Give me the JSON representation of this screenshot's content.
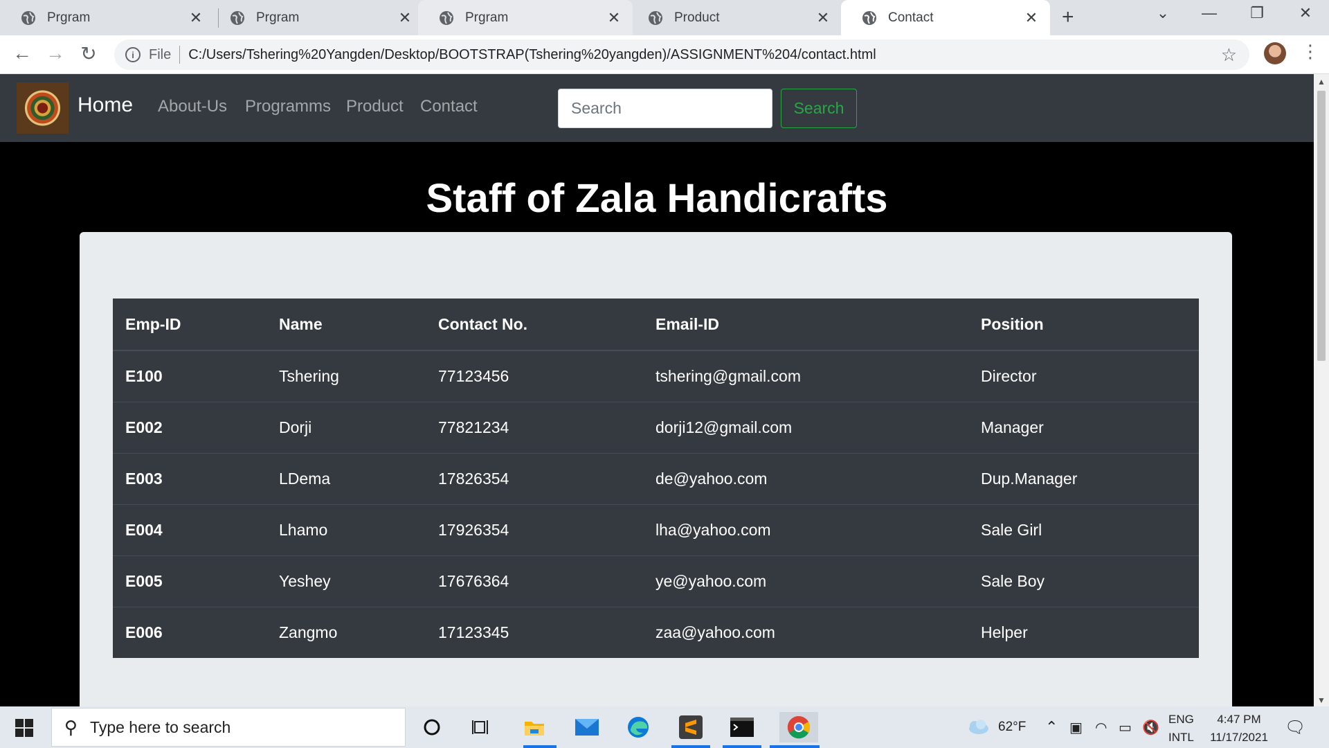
{
  "browser": {
    "tabs": [
      {
        "title": "Prgram",
        "active": false
      },
      {
        "title": "Prgram",
        "active": false
      },
      {
        "title": "Prgram",
        "active": false
      },
      {
        "title": "Product",
        "active": false
      },
      {
        "title": "Contact",
        "active": true
      }
    ],
    "address": {
      "scheme_label": "File",
      "url": "C:/Users/Tshering%20Yangden/Desktop/BOOTSTRAP(Tshering%20yangden)/ASSIGNMENT%204/contact.html"
    }
  },
  "navbar": {
    "brand": "Home",
    "links": [
      "About-Us",
      "Programms",
      "Product",
      "Contact"
    ],
    "search_placeholder": "Search",
    "search_button": "Search"
  },
  "page": {
    "title": "Staff of Zala Handicrafts"
  },
  "table": {
    "headers": [
      "Emp-ID",
      "Name",
      "Contact No.",
      "Email-ID",
      "Position"
    ],
    "rows": [
      [
        "E100",
        "Tshering",
        "77123456",
        "tshering@gmail.com",
        "Director"
      ],
      [
        "E002",
        "Dorji",
        "77821234",
        "dorji12@gmail.com",
        "Manager"
      ],
      [
        "E003",
        "LDema",
        "17826354",
        "de@yahoo.com",
        "Dup.Manager"
      ],
      [
        "E004",
        "Lhamo",
        "17926354",
        "lha@yahoo.com",
        "Sale Girl"
      ],
      [
        "E005",
        "Yeshey",
        "17676364",
        "ye@yahoo.com",
        "Sale Boy"
      ],
      [
        "E006",
        "Zangmo",
        "17123345",
        "zaa@yahoo.com",
        "Helper"
      ]
    ]
  },
  "taskbar": {
    "search_placeholder": "Type here to search",
    "weather": "62°F",
    "language": {
      "line1": "ENG",
      "line2": "INTL"
    },
    "time": "4:47 PM",
    "date": "11/17/2021",
    "apps": [
      "cortana-icon",
      "task-view-icon",
      "file-explorer-icon",
      "mail-icon",
      "edge-icon",
      "sublime-text-icon",
      "terminal-icon",
      "chrome-icon"
    ]
  },
  "colors": {
    "navbar_bg": "#343a40",
    "success_green": "#28a745",
    "table_bg": "#343a40",
    "jumbotron_bg": "#e9ecef"
  }
}
